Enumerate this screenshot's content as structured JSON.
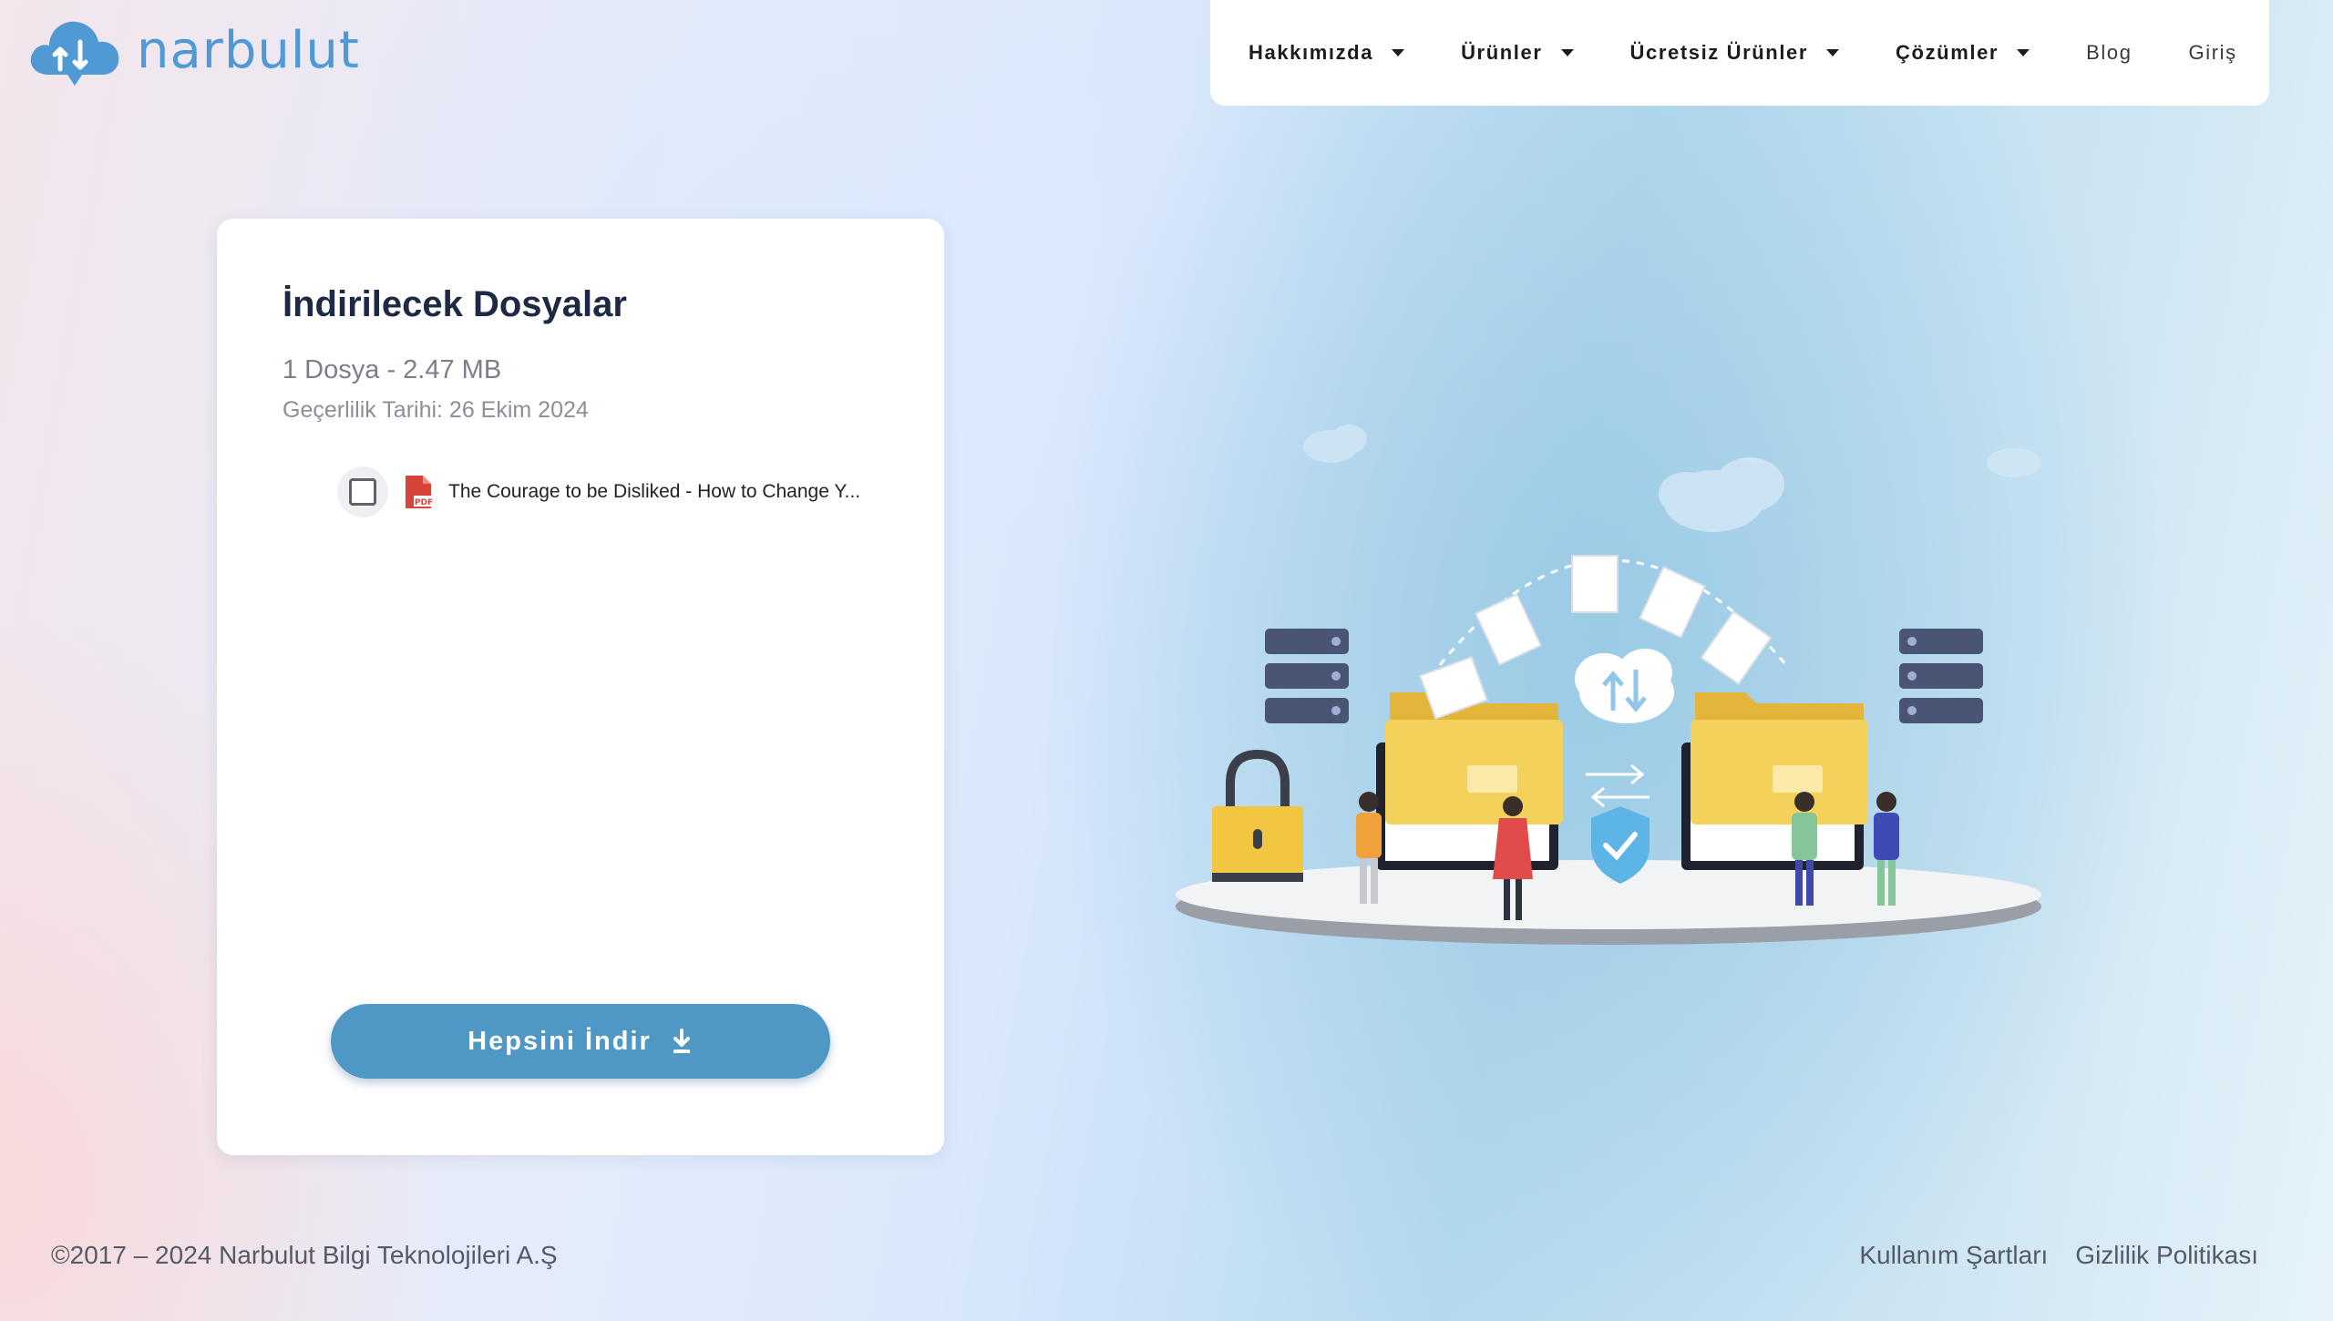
{
  "brand": {
    "name": "narbulut",
    "color": "#4f9ad4"
  },
  "nav": {
    "items": [
      {
        "label": "Hakkımızda",
        "dropdown": true
      },
      {
        "label": "Ürünler",
        "dropdown": true
      },
      {
        "label": "Ücretsiz Ürünler",
        "dropdown": true
      },
      {
        "label": "Çözümler",
        "dropdown": true
      },
      {
        "label": "Blog",
        "dropdown": false
      },
      {
        "label": "Giriş",
        "dropdown": false
      }
    ]
  },
  "card": {
    "title": "İndirilecek Dosyalar",
    "info": "1 Dosya - 2.47 MB",
    "expiry": "Geçerlilik Tarihi: 26 Ekim 2024",
    "files": [
      {
        "name": "The Courage to be Disliked - How to Change Y...",
        "icon": "pdf-icon",
        "checked": false
      }
    ],
    "download_all_label": "Hepsini İndir",
    "button_color": "#4f97c4"
  },
  "footer": {
    "copyright": "©2017 – 2024 Narbulut Bilgi Teknolojileri A.Ş",
    "links": [
      "Kullanım Şartları",
      "Gizlilik Politikası"
    ]
  }
}
